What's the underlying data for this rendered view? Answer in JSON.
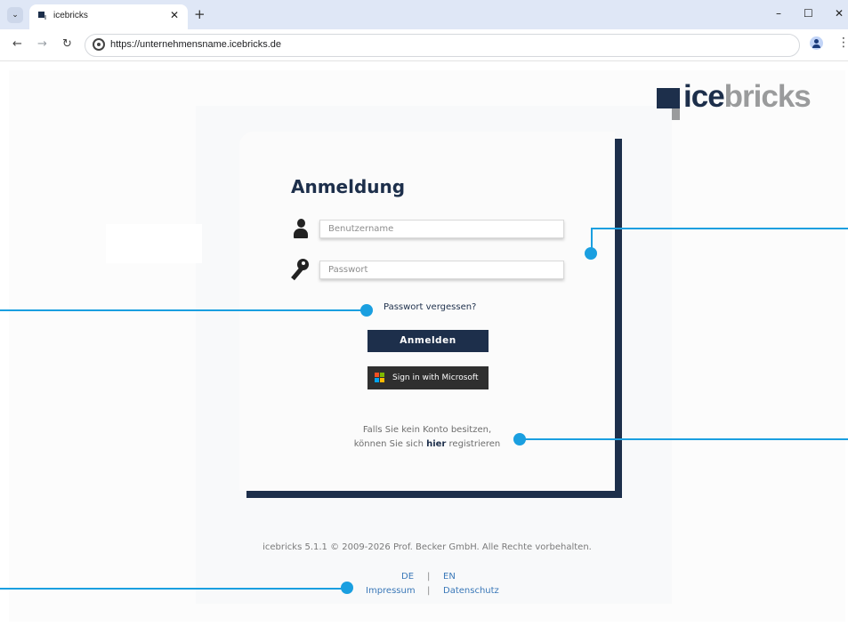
{
  "browser": {
    "tab_title": "icebricks",
    "tab_close": "✕",
    "new_tab": "+",
    "url": "https://unternehmensname.icebricks.de",
    "window_controls": {
      "minimize": "–",
      "maximize": "☐",
      "close": "✕"
    }
  },
  "logo": {
    "part1": "ice",
    "part2": "bricks"
  },
  "login": {
    "title": "Anmeldung",
    "username_placeholder": "Benutzername",
    "password_placeholder": "Passwort",
    "forgot_password": "Passwort vergessen?",
    "login_button": "Anmelden",
    "microsoft_button": "Sign in with Microsoft",
    "register_line1": "Falls Sie kein Konto besitzen,",
    "register_pre": "können Sie sich ",
    "register_link": "hier",
    "register_post": " registrieren"
  },
  "footer": {
    "copyright": "icebricks 5.1.1 © 2009-2026 Prof. Becker GmbH. Alle Rechte vorbehalten.",
    "lang_de": "DE",
    "lang_en": "EN",
    "separator": "|",
    "impressum": "Impressum",
    "datenschutz": "Datenschutz"
  },
  "colors": {
    "brand_dark": "#1d2f4b",
    "brand_grey": "#9a9b9c",
    "callout": "#1a9fe0",
    "link_blue": "#3a78b8"
  }
}
